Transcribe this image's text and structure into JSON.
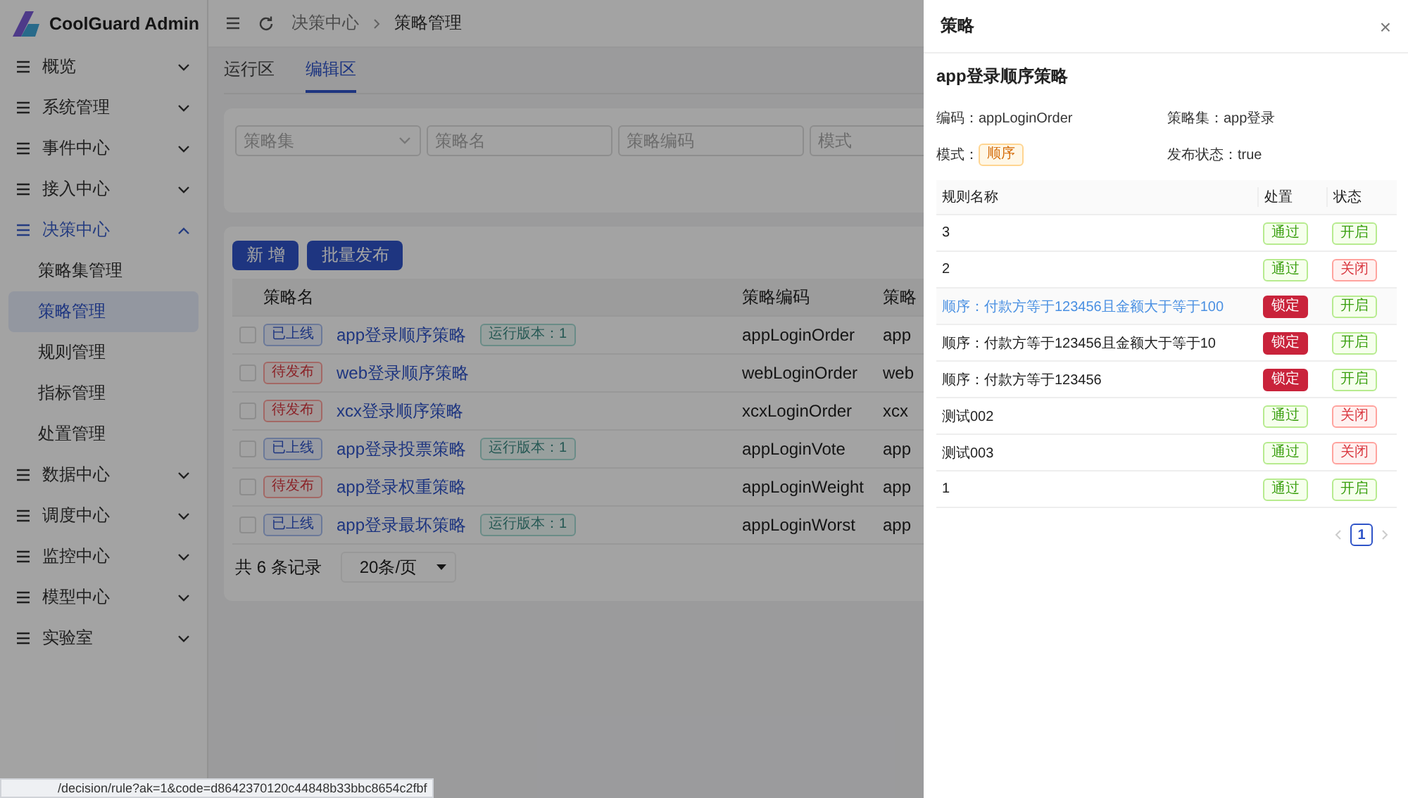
{
  "app": {
    "title": "CoolGuard Admin"
  },
  "sidebar": {
    "items": [
      {
        "label": "概览",
        "expanded": false
      },
      {
        "label": "系统管理",
        "expanded": false
      },
      {
        "label": "事件中心",
        "expanded": false
      },
      {
        "label": "接入中心",
        "expanded": false
      },
      {
        "label": "决策中心",
        "expanded": true,
        "children": [
          {
            "label": "策略集管理",
            "selected": false
          },
          {
            "label": "策略管理",
            "selected": true
          },
          {
            "label": "规则管理",
            "selected": false
          },
          {
            "label": "指标管理",
            "selected": false
          },
          {
            "label": "处置管理",
            "selected": false
          }
        ]
      },
      {
        "label": "数据中心",
        "expanded": false
      },
      {
        "label": "调度中心",
        "expanded": false
      },
      {
        "label": "监控中心",
        "expanded": false
      },
      {
        "label": "模型中心",
        "expanded": false
      },
      {
        "label": "实验室",
        "expanded": false
      }
    ]
  },
  "breadcrumb": [
    "决策中心",
    "策略管理"
  ],
  "tabs": [
    {
      "label": "运行区",
      "selected": false
    },
    {
      "label": "编辑区",
      "selected": true
    }
  ],
  "filters": [
    {
      "placeholder": "策略集",
      "kind": "select"
    },
    {
      "placeholder": "策略名",
      "kind": "input"
    },
    {
      "placeholder": "策略编码",
      "kind": "input"
    },
    {
      "placeholder": "模式",
      "kind": "input"
    }
  ],
  "actions": [
    "新 增",
    "批量发布"
  ],
  "table": {
    "columns": [
      "策略名",
      "策略编码",
      "策略"
    ],
    "rows": [
      {
        "status": {
          "label": "已上线",
          "kind": "online"
        },
        "name": "app登录顺序策略",
        "version": "运行版本：1",
        "code": "appLoginOrder",
        "set": "app",
        "checked": false
      },
      {
        "status": {
          "label": "待发布",
          "kind": "pending"
        },
        "name": "web登录顺序策略",
        "code": "webLoginOrder",
        "set": "web",
        "checked": false
      },
      {
        "status": {
          "label": "待发布",
          "kind": "pending"
        },
        "name": "xcx登录顺序策略",
        "code": "xcxLoginOrder",
        "set": "xcx",
        "checked": false
      },
      {
        "status": {
          "label": "已上线",
          "kind": "online"
        },
        "name": "app登录投票策略",
        "version": "运行版本：1",
        "code": "appLoginVote",
        "set": "app",
        "checked": false
      },
      {
        "status": {
          "label": "待发布",
          "kind": "pending"
        },
        "name": "app登录权重策略",
        "code": "appLoginWeight",
        "set": "app",
        "checked": false
      },
      {
        "status": {
          "label": "已上线",
          "kind": "online"
        },
        "name": "app登录最坏策略",
        "version": "运行版本：1",
        "code": "appLoginWorst",
        "set": "app",
        "checked": false
      }
    ],
    "total": "共 6 条记录",
    "page_size": "20条/页"
  },
  "drawer": {
    "title": "策略",
    "close": "×",
    "heading": "app登录顺序策略",
    "fields": [
      {
        "label": "编码：",
        "value": "appLoginOrder"
      },
      {
        "label": "策略集：",
        "value": "app登录"
      },
      {
        "label": "模式：",
        "tag": "顺序"
      },
      {
        "label": "发布状态：",
        "value": "true"
      }
    ],
    "columns": [
      "规则名称",
      "处置",
      "状态"
    ],
    "rules": [
      {
        "name": "3",
        "action": {
          "label": "通过",
          "kind": "pass"
        },
        "state": {
          "label": "开启",
          "on": true
        },
        "hovered": false
      },
      {
        "name": "2",
        "action": {
          "label": "通过",
          "kind": "pass"
        },
        "state": {
          "label": "关闭",
          "on": false
        },
        "hovered": false
      },
      {
        "name": "顺序：付款方等于123456且金额大于等于100",
        "action": {
          "label": "锁定",
          "kind": "lock"
        },
        "state": {
          "label": "开启",
          "on": true
        },
        "hovered": true
      },
      {
        "name": "顺序：付款方等于123456且金额大于等于10",
        "action": {
          "label": "锁定",
          "kind": "lock"
        },
        "state": {
          "label": "开启",
          "on": true
        },
        "hovered": false
      },
      {
        "name": "顺序：付款方等于123456",
        "action": {
          "label": "锁定",
          "kind": "lock"
        },
        "state": {
          "label": "开启",
          "on": true
        },
        "hovered": false
      },
      {
        "name": "测试002",
        "action": {
          "label": "通过",
          "kind": "pass"
        },
        "state": {
          "label": "关闭",
          "on": false
        },
        "hovered": false
      },
      {
        "name": "测试003",
        "action": {
          "label": "通过",
          "kind": "pass"
        },
        "state": {
          "label": "关闭",
          "on": false
        },
        "hovered": false
      },
      {
        "name": "1",
        "action": {
          "label": "通过",
          "kind": "pass"
        },
        "state": {
          "label": "开启",
          "on": true
        },
        "hovered": false
      }
    ],
    "pages": [
      {
        "label": "1",
        "selected": true
      }
    ]
  },
  "status_url": "/decision/rule?ak=1&code=d8642370120c44848b33bbc8654c2fbf"
}
